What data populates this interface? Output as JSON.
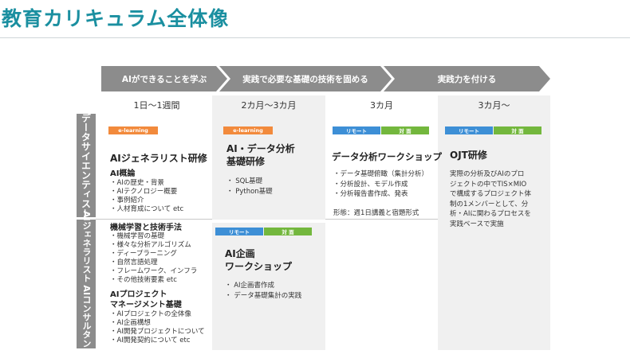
{
  "page_title": "教育カリキュラム全体像",
  "phases": [
    "AIができることを学ぶ",
    "実践で必要な基礎の技術を固める",
    "実践力を付ける"
  ],
  "durations": [
    "1日～1週間",
    "2カ月～3カ月",
    "3カ月",
    "3カ月～"
  ],
  "roles": [
    "データサイエンティスト",
    "AIジェネラリスト AIコンサルタント"
  ],
  "tags": {
    "elearning": "e-learning",
    "remote": "リモート",
    "inperson": "対 面"
  },
  "col1": {
    "title": "AIジェネラリスト研修",
    "s1_title": "AI概論",
    "s1_items": [
      "・AIの歴史・背景",
      "・AIテクノロジー概要",
      "・事例紹介",
      "・人材育成について etc"
    ],
    "s2_title": "機械学習と技術手法",
    "s2_items": [
      "・機械学習の基礎",
      "・様々な分析アルゴリズム",
      "・ディープラーニング",
      "・自然言語処理",
      "・フレームワーク、インフラ",
      "・その他技術要素 etc"
    ],
    "s3_title_1": "AIプロジェクト",
    "s3_title_2": "マネージメント基礎",
    "s3_items": [
      "・AIプロジェクトの全体像",
      "・AI企画構想",
      "・AI開発プロジェクトについて",
      "・AI開発契約について etc"
    ]
  },
  "col2_top": {
    "title_1": "AI・データ分析",
    "title_2": "基礎研修",
    "items": [
      "・ SQL基礎",
      "・ Python基礎"
    ]
  },
  "col2_bottom": {
    "title_1": "AI企画",
    "title_2": "ワークショップ",
    "items": [
      "・ AI企画書作成",
      "・ データ基礎集計の実践"
    ]
  },
  "col3": {
    "title": "データ分析ワークショップ",
    "items": [
      "・データ基礎俯瞰（集計分析）",
      "・分析設計、モデル作成",
      "・分析報告書作成、発表"
    ],
    "format": "形態：週1日講義と宿題形式"
  },
  "col4": {
    "title": "OJT研修",
    "lines": [
      "実際の分析及びAIのプロ",
      "ジェクトの中でTIS×MIO",
      "で構成するプロジェクト体",
      "制の1メンバーとして、分",
      "析・AIに関わるプロセスを",
      "実践ベースで実施"
    ]
  }
}
